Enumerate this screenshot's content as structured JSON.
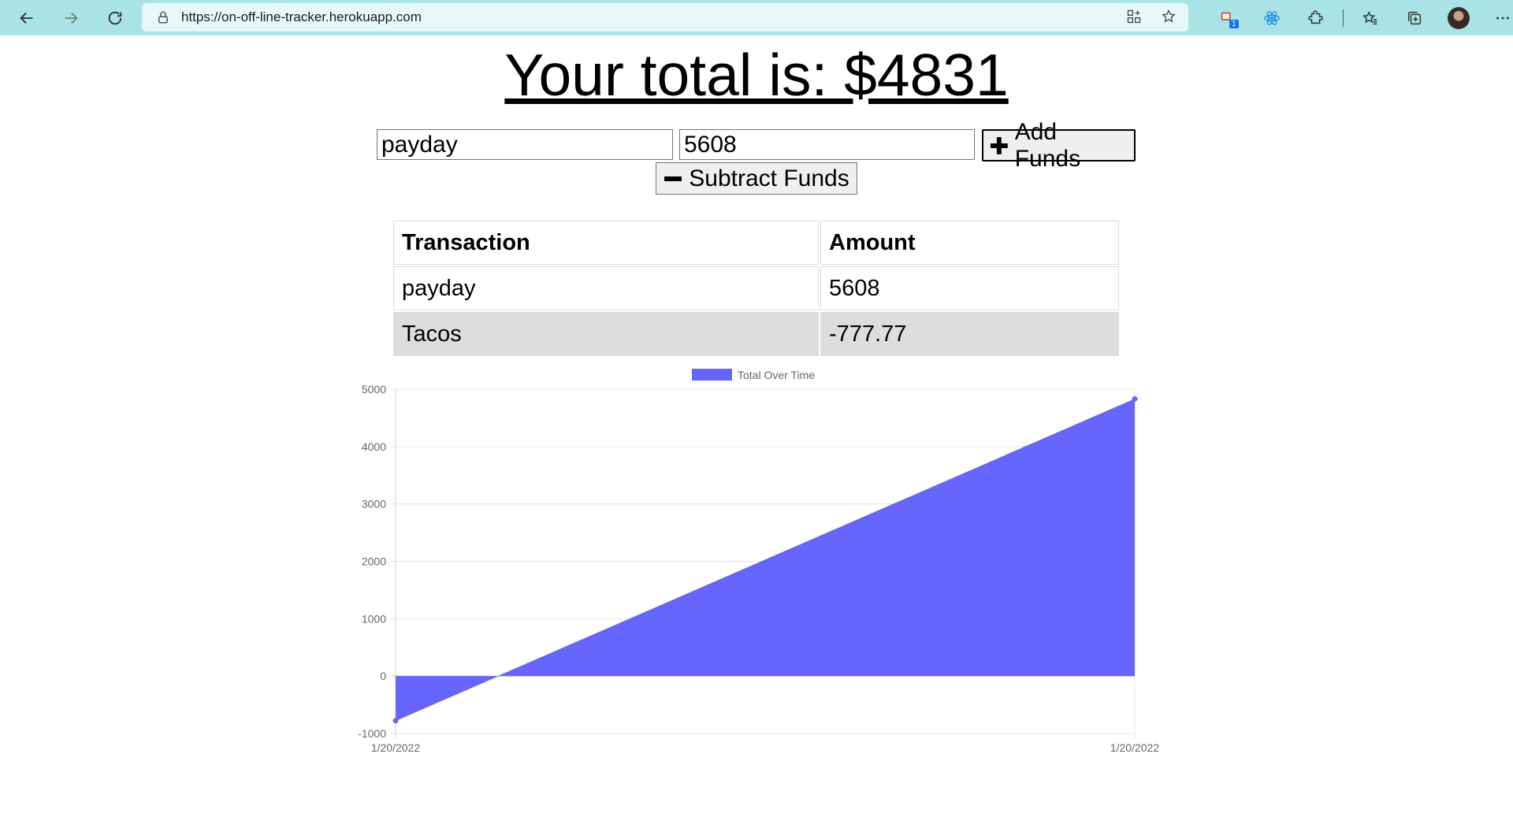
{
  "browser": {
    "url": "https://on-off-line-tracker.herokuapp.com",
    "badge_count": "1"
  },
  "page": {
    "total_label": "Your total is: $4831"
  },
  "form": {
    "name_value": "payday",
    "amount_value": "5608",
    "add_label": "Add Funds",
    "subtract_label": "Subtract Funds"
  },
  "table": {
    "headers": [
      "Transaction",
      "Amount"
    ],
    "rows": [
      {
        "name": "payday",
        "value": "5608"
      },
      {
        "name": "Tacos",
        "value": "-777.77"
      }
    ]
  },
  "chart_data": {
    "type": "area",
    "series": [
      {
        "name": "Total Over Time",
        "color": "#6666ff",
        "x": [
          "1/20/2022",
          "1/20/2022"
        ],
        "values": [
          -777.77,
          4830.23
        ]
      }
    ],
    "ylim": [
      -1000,
      5000
    ],
    "yticks": [
      5000,
      4000,
      3000,
      2000,
      1000,
      0,
      -1000
    ],
    "xticks": [
      "1/20/2022",
      "1/20/2022"
    ],
    "grid": true,
    "legend": "top"
  }
}
